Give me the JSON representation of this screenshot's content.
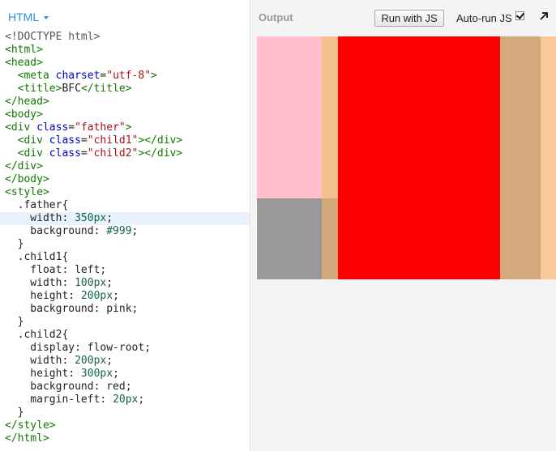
{
  "editor": {
    "tab_label": "HTML",
    "lines": [
      [
        {
          "c": "t-doc",
          "t": "<!DOCTYPE html>"
        }
      ],
      [
        {
          "c": "t-tag",
          "t": "<html>"
        }
      ],
      [
        {
          "c": "t-tag",
          "t": "<head>"
        }
      ],
      [
        {
          "c": "t-txt",
          "t": "  "
        },
        {
          "c": "t-tag",
          "t": "<meta "
        },
        {
          "c": "t-attr",
          "t": "charset"
        },
        {
          "c": "t-txt",
          "t": "="
        },
        {
          "c": "t-str",
          "t": "\"utf-8\""
        },
        {
          "c": "t-tag",
          "t": ">"
        }
      ],
      [
        {
          "c": "t-txt",
          "t": "  "
        },
        {
          "c": "t-tag",
          "t": "<title>"
        },
        {
          "c": "t-txt",
          "t": "BFC"
        },
        {
          "c": "t-tag",
          "t": "</title>"
        }
      ],
      [
        {
          "c": "t-tag",
          "t": "</head>"
        }
      ],
      [
        {
          "c": "t-tag",
          "t": "<body>"
        }
      ],
      [
        {
          "c": "t-tag",
          "t": "<div "
        },
        {
          "c": "t-attr",
          "t": "class"
        },
        {
          "c": "t-txt",
          "t": "="
        },
        {
          "c": "t-str",
          "t": "\"father\""
        },
        {
          "c": "t-tag",
          "t": ">"
        }
      ],
      [
        {
          "c": "t-txt",
          "t": "  "
        },
        {
          "c": "t-tag",
          "t": "<div "
        },
        {
          "c": "t-attr",
          "t": "class"
        },
        {
          "c": "t-txt",
          "t": "="
        },
        {
          "c": "t-str",
          "t": "\"child1\""
        },
        {
          "c": "t-tag",
          "t": "></div>"
        }
      ],
      [
        {
          "c": "t-txt",
          "t": "  "
        },
        {
          "c": "t-tag",
          "t": "<div "
        },
        {
          "c": "t-attr",
          "t": "class"
        },
        {
          "c": "t-txt",
          "t": "="
        },
        {
          "c": "t-str",
          "t": "\"child2\""
        },
        {
          "c": "t-tag",
          "t": "></div>"
        }
      ],
      [
        {
          "c": "t-tag",
          "t": "</div>"
        }
      ],
      [
        {
          "c": "t-tag",
          "t": "</body>"
        }
      ],
      [
        {
          "c": "t-tag",
          "t": "<style>"
        }
      ],
      [
        {
          "c": "t-sel",
          "t": "  .father{"
        }
      ],
      [
        {
          "c": "t-prop",
          "t": "    width: "
        },
        {
          "c": "t-num",
          "t": "350px"
        },
        {
          "c": "t-txt",
          "t": ";"
        }
      ],
      [
        {
          "c": "t-prop",
          "t": "    background: "
        },
        {
          "c": "t-num",
          "t": "#999"
        },
        {
          "c": "t-txt",
          "t": ";"
        }
      ],
      [
        {
          "c": "t-sel",
          "t": "  }"
        }
      ],
      [
        {
          "c": "t-sel",
          "t": "  .child1{"
        }
      ],
      [
        {
          "c": "t-prop",
          "t": "    float: "
        },
        {
          "c": "t-val",
          "t": "left"
        },
        {
          "c": "t-txt",
          "t": ";"
        }
      ],
      [
        {
          "c": "t-prop",
          "t": "    width: "
        },
        {
          "c": "t-num",
          "t": "100px"
        },
        {
          "c": "t-txt",
          "t": ";"
        }
      ],
      [
        {
          "c": "t-prop",
          "t": "    height: "
        },
        {
          "c": "t-num",
          "t": "200px"
        },
        {
          "c": "t-txt",
          "t": ";"
        }
      ],
      [
        {
          "c": "t-prop",
          "t": "    background: "
        },
        {
          "c": "t-val",
          "t": "pink"
        },
        {
          "c": "t-txt",
          "t": ";"
        }
      ],
      [
        {
          "c": "t-sel",
          "t": "  }"
        }
      ],
      [
        {
          "c": "t-sel",
          "t": "  .child2{"
        }
      ],
      [
        {
          "c": "t-prop",
          "t": "    display: "
        },
        {
          "c": "t-val",
          "t": "flow-root"
        },
        {
          "c": "t-txt",
          "t": ";"
        }
      ],
      [
        {
          "c": "t-prop",
          "t": "    width: "
        },
        {
          "c": "t-num",
          "t": "200px"
        },
        {
          "c": "t-txt",
          "t": ";"
        }
      ],
      [
        {
          "c": "t-prop",
          "t": "    height: "
        },
        {
          "c": "t-num",
          "t": "300px"
        },
        {
          "c": "t-txt",
          "t": ";"
        }
      ],
      [
        {
          "c": "t-prop",
          "t": "    background: "
        },
        {
          "c": "t-val",
          "t": "red"
        },
        {
          "c": "t-txt",
          "t": ";"
        }
      ],
      [
        {
          "c": "t-prop",
          "t": "    margin-left: "
        },
        {
          "c": "t-num",
          "t": "20px"
        },
        {
          "c": "t-txt",
          "t": ";"
        }
      ],
      [
        {
          "c": "t-sel",
          "t": "  }"
        }
      ],
      [
        {
          "c": "t-tag",
          "t": "</style>"
        }
      ],
      [
        {
          "c": "t-tag",
          "t": "</html>"
        }
      ]
    ],
    "active_line": 14
  },
  "output": {
    "title": "Output",
    "run_button": "Run with JS",
    "autorun_label": "Auto-run JS",
    "autorun_checked": true
  },
  "colors": {
    "tab_accent": "#2d8ed8",
    "father_bg": "#999999",
    "child1_bg": "pink",
    "child2_bg": "#ff0000"
  }
}
